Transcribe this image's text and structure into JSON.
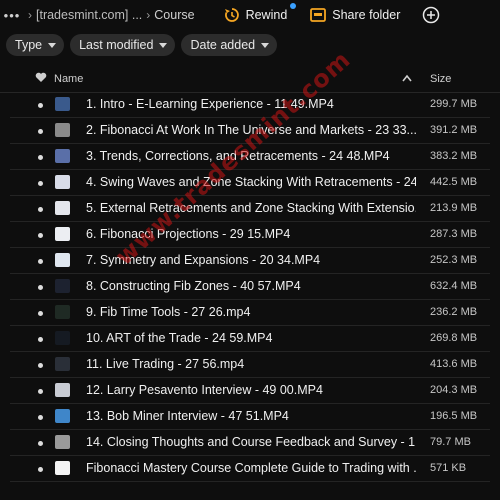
{
  "toolbar": {
    "more_icon": "more-icon",
    "breadcrumb_first": "[tradesmint.com] ...",
    "breadcrumb_current": "Course",
    "rewind_label": "Rewind",
    "share_folder_label": "Share folder",
    "accent": "#f5a623"
  },
  "filters": [
    {
      "label": "Type"
    },
    {
      "label": "Last modified"
    },
    {
      "label": "Date added"
    }
  ],
  "columns": {
    "name": "Name",
    "size": "Size"
  },
  "files": [
    {
      "name": "1. Intro - E-Learning Experience - 11 49.MP4",
      "size": "299.7 MB",
      "thumb": "#3a5a8c"
    },
    {
      "name": "2. Fibonacci At Work In The Universe and Markets - 23 33....",
      "size": "391.2 MB",
      "thumb": "#8a8a8a"
    },
    {
      "name": "3. Trends, Corrections, and Retracements - 24 48.MP4",
      "size": "383.2 MB",
      "thumb": "#5a6fa8"
    },
    {
      "name": "4. Swing Waves and Zone Stacking With Retracements - 24...",
      "size": "442.5 MB",
      "thumb": "#d8dce8"
    },
    {
      "name": "5. External Retracements and Zone Stacking With Extensio...",
      "size": "213.9 MB",
      "thumb": "#e4e6ec"
    },
    {
      "name": "6. Fibonacci Projections - 29 15.MP4",
      "size": "287.3 MB",
      "thumb": "#eceef2"
    },
    {
      "name": "7. Symmetry and Expansions - 20 34.MP4",
      "size": "252.3 MB",
      "thumb": "#dfe6ef"
    },
    {
      "name": "8. Constructing Fib Zones - 40 57.MP4",
      "size": "632.4 MB",
      "thumb": "#1d2230"
    },
    {
      "name": "9. Fib Time Tools - 27 26.mp4",
      "size": "236.2 MB",
      "thumb": "#1f2a24"
    },
    {
      "name": "10. ART of the Trade - 24 59.MP4",
      "size": "269.8 MB",
      "thumb": "#151a22"
    },
    {
      "name": "11. Live Trading - 27 56.mp4",
      "size": "413.6 MB",
      "thumb": "#2a2f38"
    },
    {
      "name": "12. Larry Pesavento Interview - 49 00.MP4",
      "size": "204.3 MB",
      "thumb": "#c9ccd4"
    },
    {
      "name": "13. Bob Miner Interview - 47 51.MP4",
      "size": "196.5 MB",
      "thumb": "#3f86c9"
    },
    {
      "name": "14. Closing Thoughts and Course Feedback and Survey - 1 ...",
      "size": "79.7 MB",
      "thumb": "#9a9a9a"
    },
    {
      "name": "Fibonacci Mastery Course Complete Guide to Trading with ...",
      "size": "571 KB",
      "thumb": "#f4f4f4"
    }
  ],
  "watermark": "www.tradesmint.com"
}
